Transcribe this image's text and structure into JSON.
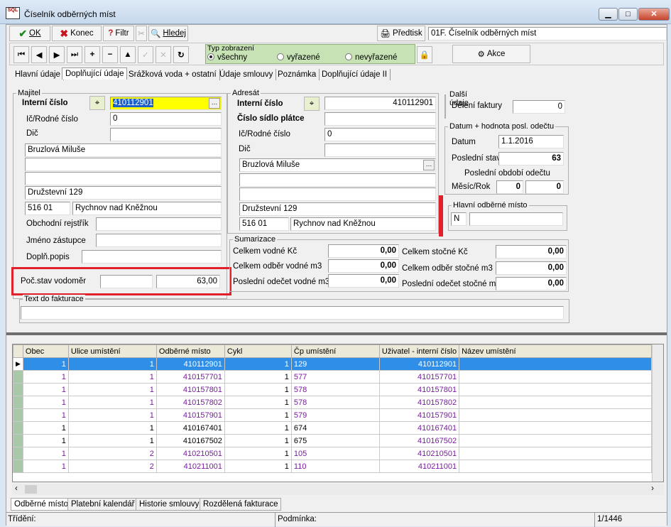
{
  "window": {
    "title": "Číselník odběrných míst",
    "logo": "SQL"
  },
  "toolbar1": {
    "ok": "OK",
    "konec": "Konec",
    "filtr": "Filtr",
    "hledej": "Hledej",
    "predtisk": "Předtisk",
    "report": "01F. Číselník odběrných míst"
  },
  "toolbar2": {
    "typ_label": "Typ zobrazení",
    "opt_all": "všechny",
    "opt_vyrazene": "vyřazené",
    "opt_nevyrazene": "nevyřazené",
    "akce": "Akce"
  },
  "tabs": [
    "Hlavní údaje",
    "Doplňující údaje",
    "Srážková voda + ostatní",
    "Údaje smlouvy",
    "Poznámka",
    "Doplňující údaje II"
  ],
  "majitel": {
    "group": "Majitel",
    "interni_label": "Interní číslo",
    "interni": "410112901",
    "ic_label": "Ič/Rodné číslo",
    "ic": "0",
    "dic_label": "Dič",
    "name": "Bruzlová Miluše",
    "street": "Družstevní 129",
    "psc": "516 01",
    "city": "Rychnov nad Kněžnou",
    "obch_label": "Obchodní rejstřík",
    "zastupce_label": "Jméno zástupce",
    "popis_label": "Doplň.popis"
  },
  "pocstav": {
    "label": "Poč.stav vodoměr",
    "value": "63,00"
  },
  "text_fakt": {
    "label": "Text do fakturace"
  },
  "adresat": {
    "group": "Adresát",
    "interni_label": "Interní číslo",
    "interni": "410112901",
    "sidlo_label": "Číslo sídlo plátce",
    "ic_label": "Ič/Rodné číslo",
    "ic": "0",
    "dic_label": "Dič",
    "name": "Bruzlová Miluše",
    "street": "Družstevní 129",
    "psc": "516 01",
    "city": "Rychnov nad Kněžnou"
  },
  "dalsi": {
    "group": "Další údaje",
    "deleni_label": "Dělení faktury",
    "deleni": "0"
  },
  "datum_grp": {
    "group": "Datum + hodnota posl. odečtu",
    "datum_label": "Datum",
    "datum": "1.1.2016",
    "stav_label": "Poslední stav",
    "stav": "63",
    "obdobi_label": "Poslední období odečtu",
    "mesic_label": "Měsíc/Rok",
    "mesic": "0",
    "rok": "0"
  },
  "hlavni": {
    "group": "Hlavní odběrné místo",
    "value": "N"
  },
  "sumarizace": {
    "group": "Sumarizace",
    "vodne_kc_label": "Celkem vodné Kč",
    "vodne_kc": "0,00",
    "odber_vodne_label": "Celkem odběr vodné m3",
    "odber_vodne": "0,00",
    "odecet_vodne_label": "Poslední odečet vodné m3",
    "odecet_vodne": "0,00",
    "stocne_kc_label": "Celkem stočné Kč",
    "stocne_kc": "0,00",
    "odber_stocne_label": "Celkem odběr stočné m3",
    "odber_stocne": "0,00",
    "odecet_stocne_label": "Poslední odečet stočné m3",
    "odecet_stocne": "0,00"
  },
  "grid": {
    "headers": [
      "Obec",
      "Ulice umístění",
      "Odběrné místo",
      "Cykl",
      "Čp umístění",
      "Uživatel - interní číslo",
      "Název umístění"
    ],
    "rows": [
      [
        "1",
        "1",
        "410112901",
        "1",
        "129",
        "410112901",
        ""
      ],
      [
        "1",
        "1",
        "410157701",
        "1",
        "577",
        "410157701",
        ""
      ],
      [
        "1",
        "1",
        "410157801",
        "1",
        "578",
        "410157801",
        ""
      ],
      [
        "1",
        "1",
        "410157802",
        "1",
        "578",
        "410157802",
        ""
      ],
      [
        "1",
        "1",
        "410157901",
        "1",
        "579",
        "410157901",
        ""
      ],
      [
        "1",
        "1",
        "410167401",
        "1",
        "674",
        "410167401",
        ""
      ],
      [
        "1",
        "1",
        "410167502",
        "1",
        "675",
        "410167502",
        ""
      ],
      [
        "1",
        "2",
        "410210501",
        "1",
        "105",
        "410210501",
        ""
      ],
      [
        "1",
        "2",
        "410211001",
        "1",
        "110",
        "410211001",
        ""
      ]
    ]
  },
  "bottom_tabs": [
    "Odběrné místo",
    "Platební kalendář",
    "Historie smlouvy",
    "Rozdělená fakturace"
  ],
  "status": {
    "trideni": "Třídění:",
    "podminka": "Podmínka:",
    "pos": "1/1446"
  }
}
